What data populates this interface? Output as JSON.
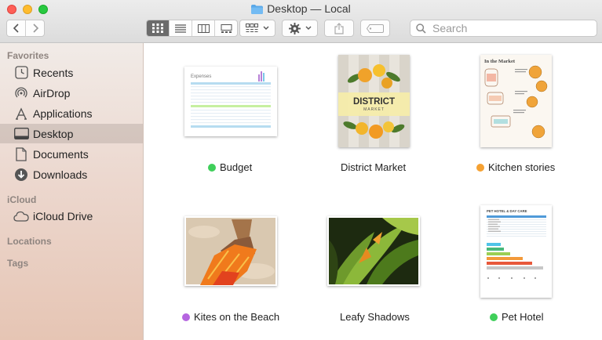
{
  "window": {
    "title": "Desktop — Local"
  },
  "toolbar": {
    "search_placeholder": "Search"
  },
  "sidebar": {
    "sections": {
      "favorites": "Favorites",
      "icloud": "iCloud",
      "locations": "Locations",
      "tags": "Tags"
    },
    "favorites": [
      {
        "label": "Recents",
        "icon": "clock-icon"
      },
      {
        "label": "AirDrop",
        "icon": "airdrop-icon"
      },
      {
        "label": "Applications",
        "icon": "applications-icon"
      },
      {
        "label": "Desktop",
        "icon": "desktop-icon",
        "selected": true
      },
      {
        "label": "Documents",
        "icon": "document-icon"
      },
      {
        "label": "Downloads",
        "icon": "download-icon"
      }
    ],
    "icloud": [
      {
        "label": "iCloud Drive",
        "icon": "cloud-icon"
      }
    ]
  },
  "files": [
    {
      "name": "Budget",
      "tag_color": "#3fcf5a"
    },
    {
      "name": "District Market",
      "tag_color": null
    },
    {
      "name": "Kitchen stories",
      "tag_color": "#f5a132"
    },
    {
      "name": "Kites on the Beach",
      "tag_color": "#b565e0"
    },
    {
      "name": "Leafy Shadows",
      "tag_color": null
    },
    {
      "name": "Pet Hotel",
      "tag_color": "#3fcf5a"
    }
  ],
  "thumbnails": {
    "budget_title": "Expenses",
    "district_title": "DISTRICT",
    "district_subtitle": "MARKET",
    "kitchen_title": "In the Market",
    "pethotel_title": "PET HOTEL & DAY CARE"
  }
}
